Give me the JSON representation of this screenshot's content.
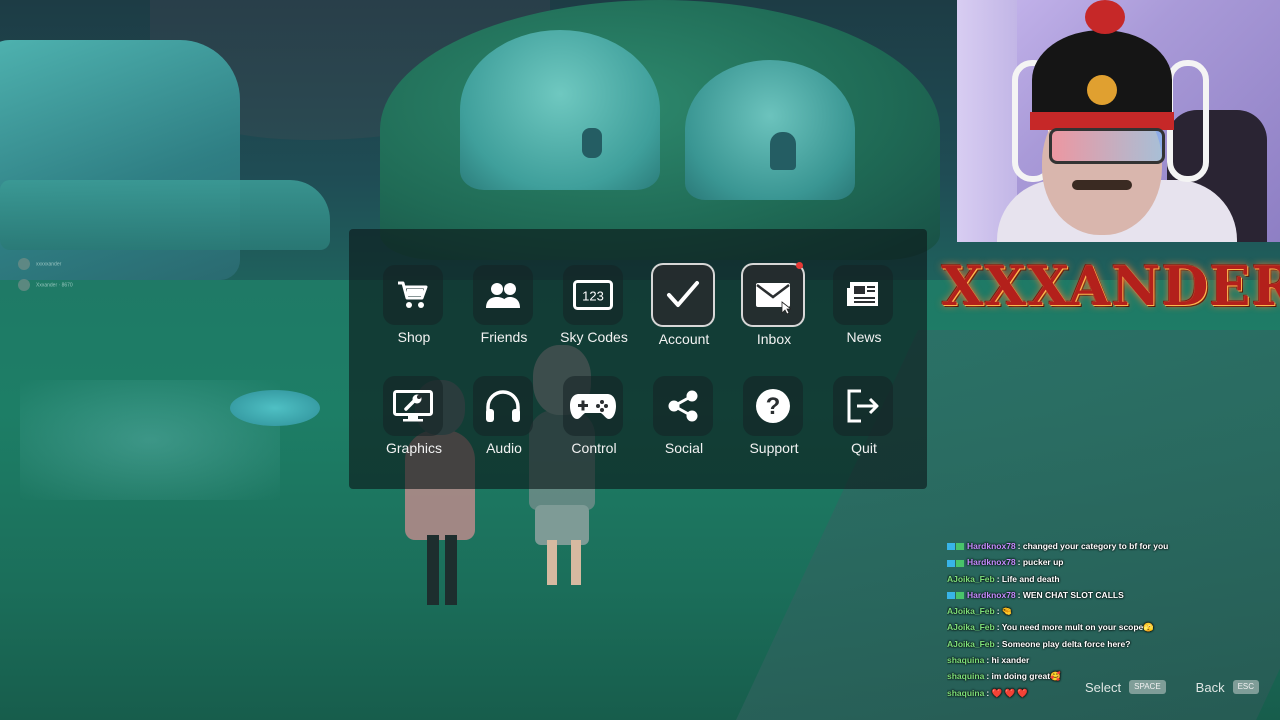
{
  "scene": {
    "players": [
      "xxxxxander",
      "Xxxander · 8670"
    ]
  },
  "menu": {
    "row1": [
      {
        "label": "Shop",
        "icon": "cart-icon"
      },
      {
        "label": "Friends",
        "icon": "friends-icon"
      },
      {
        "label": "Sky Codes",
        "icon": "sky-codes-icon",
        "icon_text": "123"
      },
      {
        "label": "Account",
        "icon": "checkmark-icon",
        "selected": true
      },
      {
        "label": "Inbox",
        "icon": "envelope-icon",
        "notification": true
      },
      {
        "label": "News",
        "icon": "newspaper-icon"
      }
    ],
    "row2": [
      {
        "label": "Graphics",
        "icon": "monitor-wrench-icon"
      },
      {
        "label": "Audio",
        "icon": "headphones-icon"
      },
      {
        "label": "Control",
        "icon": "gamepad-icon"
      },
      {
        "label": "Social",
        "icon": "share-icon"
      },
      {
        "label": "Support",
        "icon": "question-icon"
      },
      {
        "label": "Quit",
        "icon": "exit-icon"
      }
    ]
  },
  "brand": {
    "text": "XXXANDER"
  },
  "chat": [
    {
      "user": "Hardknox78",
      "color": "#c58cff",
      "mod": true,
      "message": ": changed your category to bf for you"
    },
    {
      "user": "Hardknox78",
      "color": "#c58cff",
      "mod": true,
      "message": ": pucker up"
    },
    {
      "user": "AJoika_Feb",
      "color": "#7ee07a",
      "mod": false,
      "message": ": Life and death"
    },
    {
      "user": "Hardknox78",
      "color": "#c58cff",
      "mod": true,
      "message": ": WEN CHAT SLOT CALLS"
    },
    {
      "user": "AJoika_Feb",
      "color": "#7ee07a",
      "mod": false,
      "message": ": 🤏"
    },
    {
      "user": "AJoika_Feb",
      "color": "#7ee07a",
      "mod": false,
      "message": ": You need more mult on your scope🫣"
    },
    {
      "user": "AJoika_Feb",
      "color": "#7ee07a",
      "mod": false,
      "message": ": Someone play delta force here?"
    },
    {
      "user": "shaquina",
      "color": "#7ee07a",
      "mod": false,
      "message": ": hi xander"
    },
    {
      "user": "shaquina",
      "color": "#7ee07a",
      "mod": false,
      "message": ": im doing great🥰"
    },
    {
      "user": "shaquina",
      "color": "#7ee07a",
      "mod": false,
      "message": ": ❤️ ❤️ ❤️"
    }
  ],
  "hints": {
    "select_label": "Select",
    "select_key": "SPACE",
    "back_label": "Back",
    "back_key": "ESC"
  }
}
